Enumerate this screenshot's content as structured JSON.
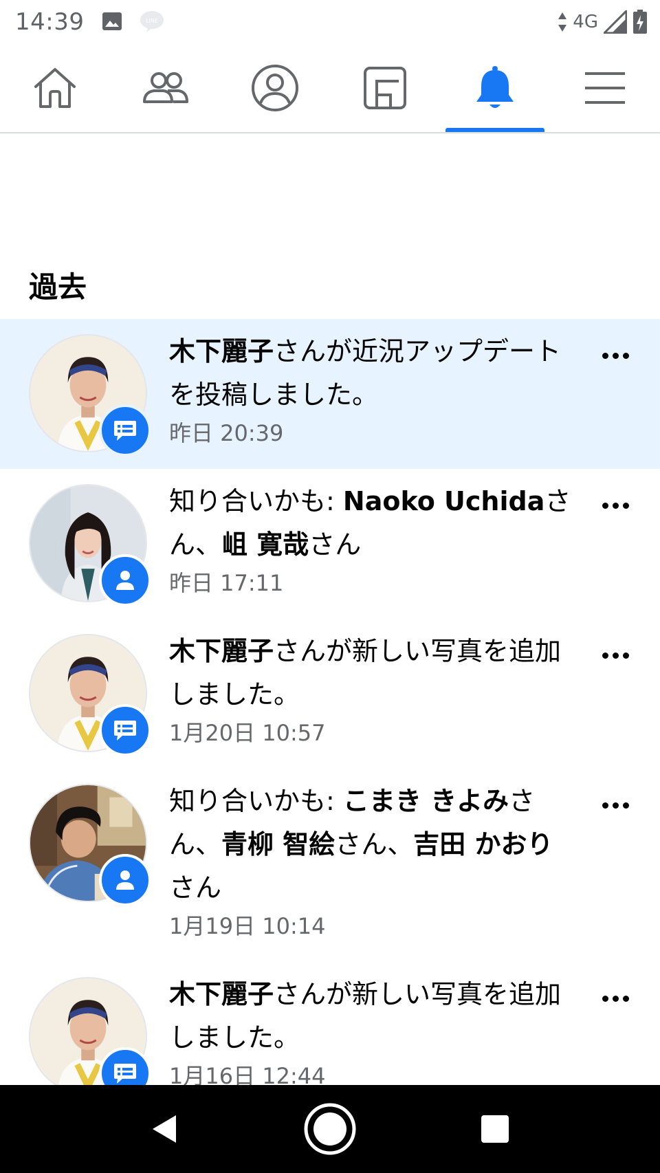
{
  "status_bar": {
    "time": "14:39",
    "network": "4G",
    "icons": [
      "image-icon",
      "line-icon",
      "data-arrows-icon",
      "signal-icon",
      "battery-charging-icon"
    ]
  },
  "nav": {
    "tabs": [
      {
        "name": "home",
        "icon": "home-icon"
      },
      {
        "name": "friends",
        "icon": "friends-icon"
      },
      {
        "name": "profile",
        "icon": "profile-icon"
      },
      {
        "name": "pages",
        "icon": "pages-icon"
      },
      {
        "name": "notifications",
        "icon": "bell-icon",
        "active": true
      },
      {
        "name": "menu",
        "icon": "hamburger-icon"
      }
    ],
    "accent_color": "#1877f2"
  },
  "section": {
    "title": "過去"
  },
  "notifications": [
    {
      "unread": true,
      "avatar": "kinoshita",
      "badge": "comment-icon",
      "name": "木下麗子",
      "text": "さんが近況アップデートを投稿しました。",
      "time": "昨日 20:39"
    },
    {
      "unread": false,
      "avatar": "naoko",
      "badge": "person-icon",
      "prefix": "知り合いかも: ",
      "name1": "Naoko Uchida",
      "mid1": "さん、",
      "name2": "岨 寛哉",
      "suffix": "さん",
      "time": "昨日 17:11"
    },
    {
      "unread": false,
      "avatar": "kinoshita",
      "badge": "comment-icon",
      "name": "木下麗子",
      "text": "さんが新しい写真を追加しました。",
      "time": "1月20日 10:57"
    },
    {
      "unread": false,
      "avatar": "kitchen",
      "badge": "person-icon",
      "prefix": "知り合いかも: ",
      "name1": "こまき きよみ",
      "mid1": "さん、",
      "name2": "青柳 智絵",
      "mid2": "さん、",
      "name3": "吉田 かおり",
      "suffix": "さん",
      "time": "1月19日 10:14"
    },
    {
      "unread": false,
      "avatar": "kinoshita",
      "badge": "comment-icon",
      "name": "木下麗子",
      "text": "さんが新しい写真を追加しました。",
      "time": "1月16日 12:44"
    }
  ],
  "system_nav": {
    "buttons": [
      "back-icon",
      "home-circle-icon",
      "recents-icon"
    ]
  }
}
